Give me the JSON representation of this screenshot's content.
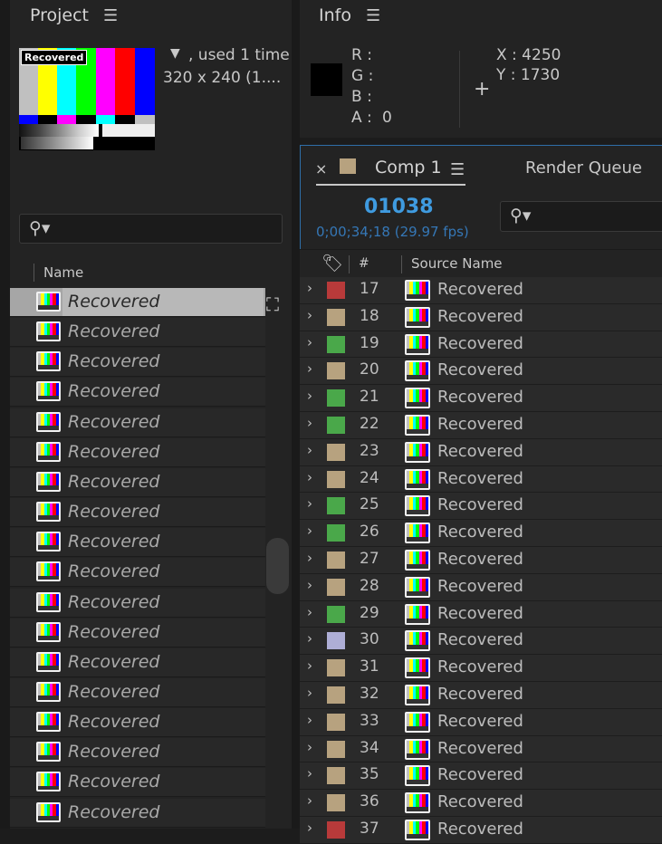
{
  "colors": {
    "label_red": "#b83a3a",
    "label_tan": "#b7a27f",
    "label_green": "#4aa84a",
    "label_lavender": "#aeaed6",
    "timecode": "#3f9be0"
  },
  "project": {
    "title": "Project",
    "thumb_label": "Recovered",
    "usage": ", used 1 time",
    "dims": "320 x 240 (1....",
    "column_name": "Name",
    "items": [
      "Recovered",
      "Recovered",
      "Recovered",
      "Recovered",
      "Recovered",
      "Recovered",
      "Recovered",
      "Recovered",
      "Recovered",
      "Recovered",
      "Recovered",
      "Recovered",
      "Recovered",
      "Recovered",
      "Recovered",
      "Recovered",
      "Recovered",
      "Recovered"
    ]
  },
  "info": {
    "title": "Info",
    "r_label": "R :",
    "g_label": "G :",
    "b_label": "B :",
    "a_label": "A :",
    "a_value": "0",
    "x_readout": "X : 4250",
    "y_readout": "Y : 1730"
  },
  "comp": {
    "tab_close": "×",
    "tab_label": "Comp 1",
    "render_queue": "Render Queue",
    "timecode": "01038",
    "sub_timecode": "0;00;34;18 (29.97 fps)",
    "col_num": "#",
    "col_source": "Source Name",
    "layers": [
      {
        "num": "17",
        "label": "label_red",
        "name": "Recovered"
      },
      {
        "num": "18",
        "label": "label_tan",
        "name": "Recovered"
      },
      {
        "num": "19",
        "label": "label_green",
        "name": "Recovered"
      },
      {
        "num": "20",
        "label": "label_tan",
        "name": "Recovered"
      },
      {
        "num": "21",
        "label": "label_green",
        "name": "Recovered"
      },
      {
        "num": "22",
        "label": "label_green",
        "name": "Recovered"
      },
      {
        "num": "23",
        "label": "label_tan",
        "name": "Recovered"
      },
      {
        "num": "24",
        "label": "label_tan",
        "name": "Recovered"
      },
      {
        "num": "25",
        "label": "label_green",
        "name": "Recovered"
      },
      {
        "num": "26",
        "label": "label_green",
        "name": "Recovered"
      },
      {
        "num": "27",
        "label": "label_tan",
        "name": "Recovered"
      },
      {
        "num": "28",
        "label": "label_tan",
        "name": "Recovered"
      },
      {
        "num": "29",
        "label": "label_green",
        "name": "Recovered"
      },
      {
        "num": "30",
        "label": "label_lavender",
        "name": "Recovered"
      },
      {
        "num": "31",
        "label": "label_tan",
        "name": "Recovered"
      },
      {
        "num": "32",
        "label": "label_tan",
        "name": "Recovered"
      },
      {
        "num": "33",
        "label": "label_tan",
        "name": "Recovered"
      },
      {
        "num": "34",
        "label": "label_tan",
        "name": "Recovered"
      },
      {
        "num": "35",
        "label": "label_tan",
        "name": "Recovered"
      },
      {
        "num": "36",
        "label": "label_tan",
        "name": "Recovered"
      },
      {
        "num": "37",
        "label": "label_red",
        "name": "Recovered"
      }
    ]
  }
}
